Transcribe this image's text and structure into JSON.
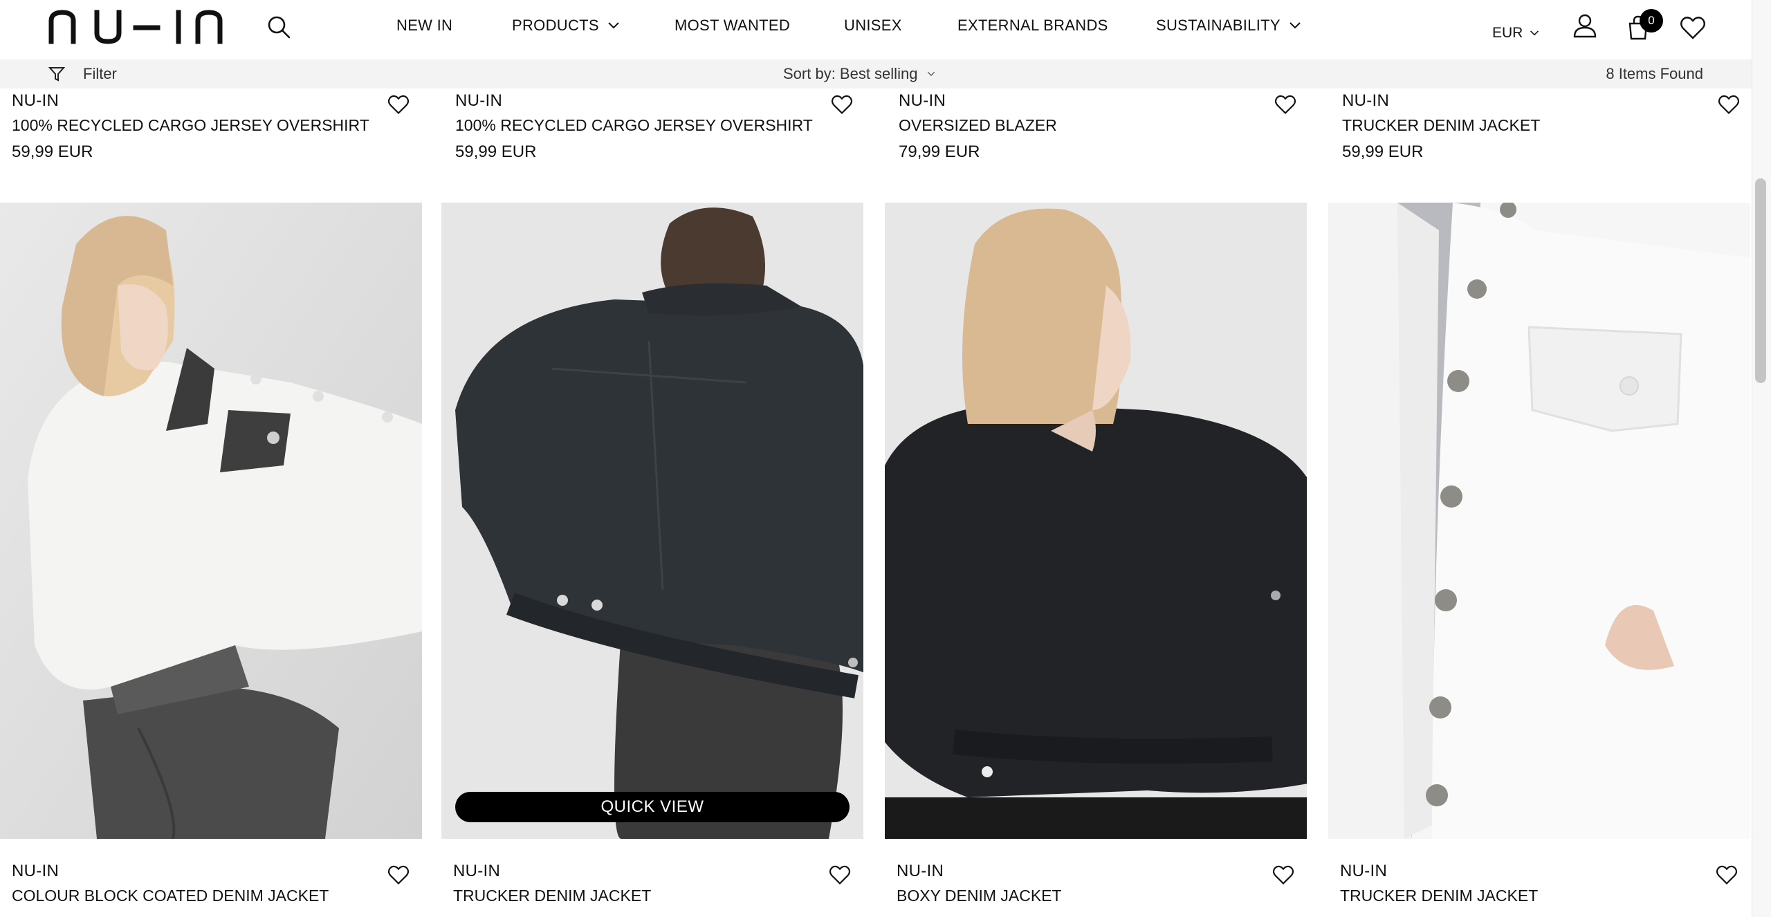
{
  "header": {
    "logo_text": "NU-IN",
    "nav": [
      {
        "label": "NEW IN",
        "has_dropdown": false
      },
      {
        "label": "PRODUCTS",
        "has_dropdown": true
      },
      {
        "label": "MOST WANTED",
        "has_dropdown": false
      },
      {
        "label": "UNISEX",
        "has_dropdown": false
      },
      {
        "label": "EXTERNAL BRANDS",
        "has_dropdown": false
      },
      {
        "label": "SUSTAINABILITY",
        "has_dropdown": true
      }
    ],
    "currency": "EUR",
    "cart_count": "0"
  },
  "filterbar": {
    "filter_label": "Filter",
    "sort_label": "Sort by: Best selling",
    "items_found": "8 Items Found"
  },
  "products_row1": [
    {
      "brand": "NU-IN",
      "name": "100% RECYCLED CARGO JERSEY OVERSHIRT",
      "price": "59,99 EUR"
    },
    {
      "brand": "NU-IN",
      "name": "100% RECYCLED CARGO JERSEY OVERSHIRT",
      "price": "59,99 EUR"
    },
    {
      "brand": "NU-IN",
      "name": "OVERSIZED BLAZER",
      "price": "79,99 EUR"
    },
    {
      "brand": "NU-IN",
      "name": "TRUCKER DENIM JACKET",
      "price": "59,99 EUR"
    }
  ],
  "products_row2": [
    {
      "brand": "NU-IN",
      "name": "COLOUR BLOCK COATED DENIM JACKET"
    },
    {
      "brand": "NU-IN",
      "name": "TRUCKER DENIM JACKET",
      "quick_view": "QUICK VIEW"
    },
    {
      "brand": "NU-IN",
      "name": "BOXY DENIM JACKET"
    },
    {
      "brand": "NU-IN",
      "name": "TRUCKER DENIM JACKET"
    }
  ],
  "icons": [
    "search-icon",
    "chevron-down-icon",
    "user-icon",
    "cart-icon",
    "heart-icon",
    "filter-icon"
  ],
  "colors": {
    "accent": "#000000",
    "filterbar_bg": "#f3f3f3",
    "text": "#111111"
  }
}
